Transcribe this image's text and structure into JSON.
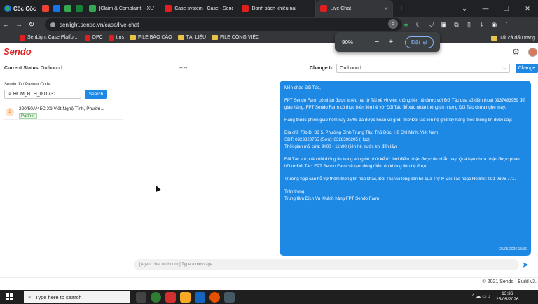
{
  "browser": {
    "brand": "Cốc Cốc",
    "tabs": [
      {
        "label": "[Claim & Complaint] - XỬ",
        "active": false
      },
      {
        "label": "Case system | Case - Send",
        "active": false
      },
      {
        "label": "Danh sách khiếu nại",
        "active": false
      },
      {
        "label": "Live Chat",
        "active": true
      }
    ],
    "url": "senlight.sendo.vn/case/live-chat",
    "bookmarks": [
      "SenLight Case Platfor...",
      "OPC",
      "tms",
      "FILE BÁO CÁO",
      "TÀI LIỆU",
      "FILE CÔNG VIỆC"
    ],
    "bookmarks_right": "Tất cả dấu trang",
    "zoom": {
      "value": "90%",
      "minus": "−",
      "plus": "+",
      "reset": "Đặt lại"
    }
  },
  "app": {
    "logo": "Sendo",
    "status": {
      "label": "Current Status:",
      "value": "Outbound",
      "middle": "--:--",
      "change_to_label": "Change to",
      "select_value": "Outbound",
      "change_button": "Change"
    },
    "left": {
      "id_label": "Sendo ID / Partner Code:",
      "id_value": "HCM_BTH_001731",
      "search_button": "Search",
      "conversations": [
        {
          "badge": "2",
          "name": "220/50A/45C Xô Viết Nghệ Tĩnh, Phườn...",
          "tag": "Partner"
        }
      ]
    },
    "message": {
      "greeting": "Mến chào Đối Tác,",
      "p1": "FPT Sendo Farm có nhận được khiếu nại từ Tài xế về việc không liên hệ được với Đối Tác qua số điện thoại 0937483959 để giao hàng. FPT Sendo Farm có thực hiện liên hệ với Đối Tác để xác nhận thông tin nhưng Đối Tác chưa nghe máy.",
      "p2": "Hàng thuộc phiên giao hôm nay 25/05 đã được hoàn về grid, nhờ Đối tác liên hệ grid lấy hàng theo thông tin dưới đây:",
      "addr": "Địa chỉ: 70b Đ. Số 5, Phường Bình Trưng Tây, Thủ Đức, Hồ Chí Minh, Việt Nam",
      "phone": "SĐT: 0923820765 (Sơn); 0328390205 (Học)",
      "hours": "Thời gian mở cửa: 9h00 - 11h00 (liên hệ trước khi đến lấy)",
      "p3": "Đối Tác vui phản hồi thông tin trong vòng 60 phút kể từ thời điểm nhận được tin nhắn này. Quá hạn chưa nhận được phản hồi từ Đối Tác, FPT Sendo Farm sẽ tạm đóng điểm do không liên hệ được.",
      "p4": "Trường hợp cần hỗ trợ thêm thông tin nào khác, Đối Tác vui lòng liên hệ qua Trợ lý Đối Tác hoặc Hotline: 091 9696 771.",
      "sign1": "Trân trọng,",
      "sign2": "Trung tâm Dịch Vụ Khách hàng FPT Sendo Farm",
      "timestamp": "25/05/2026 13:36"
    },
    "composer_placeholder": "[Agent chat outbound] Type a message...",
    "footer": "© 2021 Sendo | Build v3."
  },
  "taskbar": {
    "search_placeholder": "Type here to search",
    "time": "13:36",
    "date": "25/05/2026"
  },
  "icons": {
    "search": "search-icon",
    "settings": "gear-icon",
    "send": "send-icon"
  }
}
